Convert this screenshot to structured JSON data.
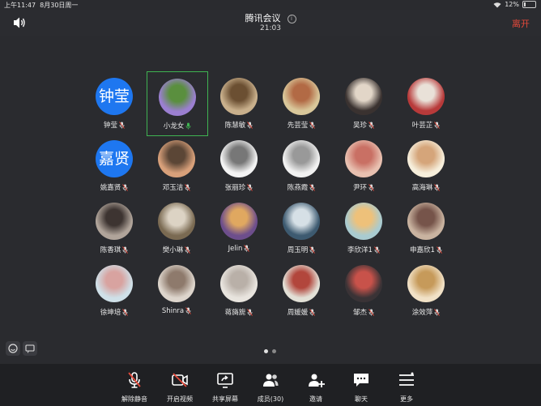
{
  "status": {
    "time": "上午11:47",
    "date": "8月30日周一",
    "battery": "12%",
    "battery_level": 0.12
  },
  "header": {
    "title": "腾讯会议",
    "timer": "21:03",
    "leave_label": "离开"
  },
  "participants": [
    {
      "name": "钟莹",
      "avatar_text": "钟莹",
      "muted": true
    },
    {
      "name": "小龙女",
      "muted": false,
      "active": true
    },
    {
      "name": "陈慧敏",
      "muted": true
    },
    {
      "name": "先芸莹",
      "muted": true
    },
    {
      "name": "吴珍",
      "muted": true
    },
    {
      "name": "叶芸芷",
      "muted": true
    },
    {
      "name": "姚嘉贤",
      "avatar_text": "嘉贤",
      "muted": true
    },
    {
      "name": "邓玉洁",
      "muted": true
    },
    {
      "name": "张丽珍",
      "muted": true
    },
    {
      "name": "陈燕霞",
      "muted": true
    },
    {
      "name": "尹环",
      "muted": true
    },
    {
      "name": "高海琳",
      "muted": true
    },
    {
      "name": "陈香琪",
      "muted": true
    },
    {
      "name": "樊小琳",
      "muted": true
    },
    {
      "name": "Jelin",
      "muted": true
    },
    {
      "name": "周玉明",
      "muted": true
    },
    {
      "name": "李欣洋1",
      "muted": true
    },
    {
      "name": "申嘉欣1",
      "muted": true
    },
    {
      "name": "徐坤培",
      "muted": true
    },
    {
      "name": "Shinra",
      "muted": true
    },
    {
      "name": "蒋旖旎",
      "muted": true
    },
    {
      "name": "周媛媛",
      "muted": true
    },
    {
      "name": "邹杰",
      "muted": true
    },
    {
      "name": "涂效萍",
      "muted": true
    }
  ],
  "toolbar": {
    "unmute": "解除静音",
    "video": "开启视频",
    "share": "共享屏幕",
    "members": "成员(30)",
    "invite": "邀请",
    "chat": "聊天",
    "more": "更多"
  },
  "pagination": {
    "pages": 2,
    "current": 1
  },
  "colors": {
    "accent_blue": "#1e77f0",
    "active_border": "#3fb352",
    "leave_red": "#e5493a",
    "mute_red": "#e5493a"
  }
}
